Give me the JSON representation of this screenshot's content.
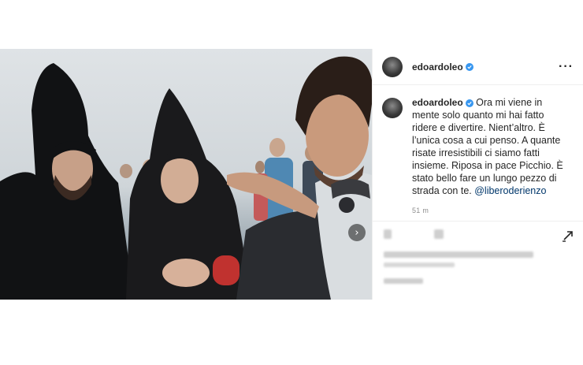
{
  "post": {
    "author": "edoardoleo",
    "verified": true,
    "more_icon": "more-horizontal-icon",
    "caption_username": "edoardoleo",
    "caption_text": "Ora mi viene in mente solo quanto mi hai fatto ridere e divertire. Nient’altro. È l’unica cosa a cui penso. A quante risate irresistibili ci siamo fatti insieme. Riposa in pace Picchio. È stato bello fare un lungo pezzo di strada con te.",
    "mention": "@liberoderienzo",
    "time_ago": "51 m",
    "carousel_icon": "chevron-right-icon",
    "share_icon": "share-icon"
  },
  "colors": {
    "verified_badge": "#3897f0",
    "mention": "#00376b",
    "muted_text": "#8e8e8e",
    "divider": "#efefef"
  }
}
